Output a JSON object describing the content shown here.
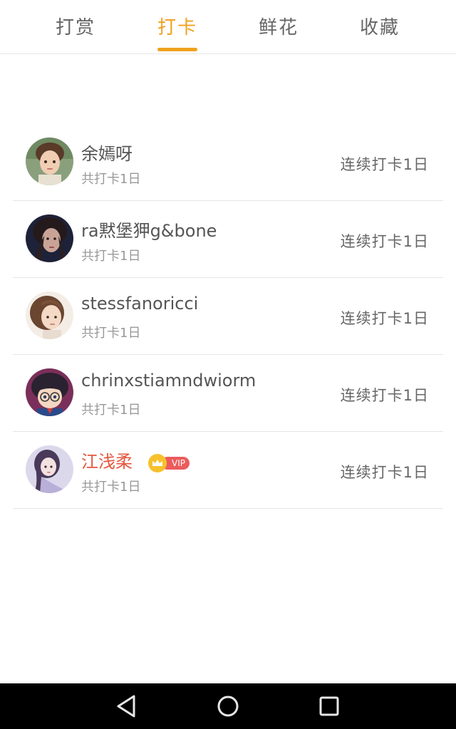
{
  "tabs": [
    {
      "label": "打赏",
      "active": false
    },
    {
      "label": "打卡",
      "active": true
    },
    {
      "label": "鲜花",
      "active": false
    },
    {
      "label": "收藏",
      "active": false
    }
  ],
  "colors": {
    "accent": "#f0a21f",
    "vip_name": "#e4573f",
    "vip_pill": "#ec5b5b",
    "vip_crown": "#f6c12b"
  },
  "list": {
    "items": [
      {
        "name": "余嫣呀",
        "total": "共打卡1日",
        "streak": "连续打卡1日",
        "avatar": "avatar-boy-photo"
      },
      {
        "name": "ra黙堡狎g&bone",
        "total": "共打卡1日",
        "streak": "连续打卡1日",
        "avatar": "avatar-woman-dark-photo"
      },
      {
        "name": "stessfanoricci",
        "total": "共打卡1日",
        "streak": "连续打卡1日",
        "avatar": "avatar-girl-photo"
      },
      {
        "name": "chrinxstiamndwiorm",
        "total": "共打卡1日",
        "streak": "连续打卡1日",
        "avatar": "avatar-anime-boy"
      },
      {
        "name": "江浅柔",
        "total": "共打卡1日",
        "streak": "连续打卡1日",
        "avatar": "avatar-anime-girl",
        "vip": true,
        "vip_label": "VIP"
      }
    ]
  },
  "navbar": {
    "icons": [
      "back-icon",
      "home-icon",
      "recents-icon"
    ]
  }
}
